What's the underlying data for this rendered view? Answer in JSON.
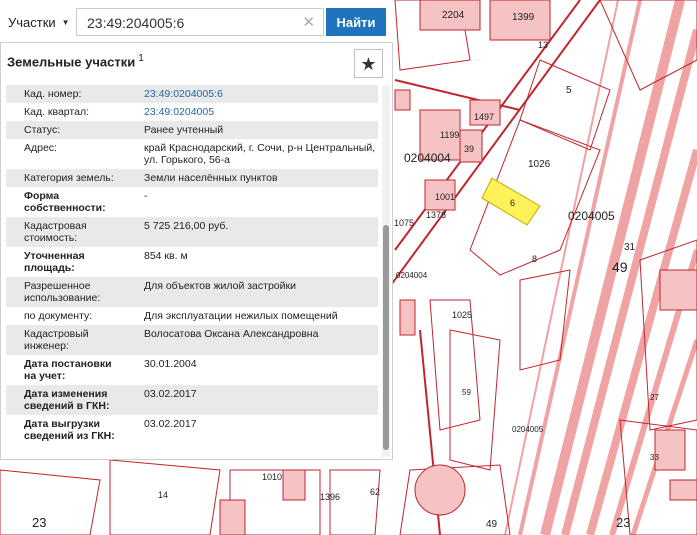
{
  "search": {
    "type_label": "Участки",
    "value": "23:49:204005:6",
    "button_label": "Найти"
  },
  "panel": {
    "title": "Земельные участки",
    "title_badge": "1",
    "properties": [
      {
        "key": "Кад. номер:",
        "value": "23:49:0204005:6",
        "link": true
      },
      {
        "key": "Кад. квартал:",
        "value": "23:49:0204005",
        "link": true
      },
      {
        "key": "Статус:",
        "value": "Ранее учтенный"
      },
      {
        "key": "Адрес:",
        "value": "край Краснодарский, г. Сочи, р-н Центральный, ул. Горького, 56-а"
      },
      {
        "key": "Категория земель:",
        "value": "Земли населённых пунктов"
      },
      {
        "key": "Форма собственности:",
        "value": "-"
      },
      {
        "key": "Кадастровая стоимость:",
        "value": "5 725 216,00 руб."
      },
      {
        "key": "Уточненная площадь:",
        "value": "854 кв. м"
      },
      {
        "key": "Разрешенное использование:",
        "value": "Для объектов жилой застройки"
      },
      {
        "key": "по документу:",
        "value": "Для эксплуатации нежилых помещений"
      },
      {
        "key": "Кадастровый инженер:",
        "value": "Волосатова Оксана Александровна"
      },
      {
        "key": "Дата постановки на учет:",
        "value": "30.01.2004"
      },
      {
        "key": "Дата изменения сведений в ГКН:",
        "value": "03.02.2017"
      },
      {
        "key": "Дата выгрузки сведений из ГКН:",
        "value": "03.02.2017"
      }
    ]
  },
  "map": {
    "labels": {
      "l2204": "2204",
      "l1399": "1399",
      "l13": "13",
      "l5": "5",
      "l1026": "1026",
      "l0204004": "0204004",
      "l0204005": "0204005",
      "l6": "6",
      "l8": "8",
      "l31": "31",
      "l49a": "49",
      "l1025": "1025",
      "l1075": "1075",
      "l1497": "1497",
      "l1199": "1199",
      "l39": "39",
      "l1001": "1001",
      "l1378": "1378",
      "l23a": "23",
      "l23b": "23",
      "l49b": "49",
      "l14": "14",
      "l1010": "1010",
      "l1396": "1396",
      "l62": "62",
      "l0204005b": "0204005",
      "l0204004b": "0204004",
      "l59": "59",
      "l27": "27",
      "l33": "33"
    },
    "colors": {
      "parcel_fill": "#f5c3c3",
      "parcel_line": "#c0262c",
      "selected_fill": "#fff15a",
      "rail": "#f0a3a3"
    }
  }
}
